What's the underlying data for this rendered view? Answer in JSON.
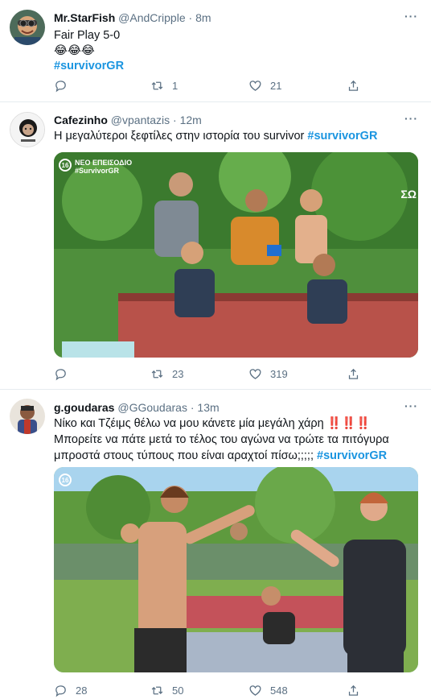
{
  "tweets": [
    {
      "name": "Mr.StarFish",
      "handle": "@AndCripple",
      "time": "8m",
      "line1": "Fair Play 5-0",
      "line2": "😂😂😂",
      "hashtag": "#survivorGR",
      "replies": "",
      "retweets": "1",
      "likes": "21"
    },
    {
      "name": "Cafezinho",
      "handle": "@vpantazis",
      "time": "12m",
      "text": "Η μεγαλύτεροι ξεφτίλες στην ιστορία του survivor",
      "hashtag": "#survivorGR",
      "media_badge": "16",
      "media_overlay": "ΝΕΟ ΕΠΕΙΣΟΔΙΟ #SurvivorGR",
      "media_corner": "ΣΩ",
      "replies": "",
      "retweets": "23",
      "likes": "319"
    },
    {
      "name": "g.goudaras",
      "handle": "@GGoudaras",
      "time": "13m",
      "text_a": "Νίκο και Τζέιμς θέλω να μου κάνετε μία μεγάλη χάρη",
      "excl": "‼️‼️‼️",
      "text_b": "Μπορείτε να πάτε μετά το τέλος του αγώνα να τρώτε τα πιτόγυρα μπροστά στους τύπους που είναι αραχτοί πίσω;;;;;",
      "hashtag": "#survivorGR",
      "media_badge": "16",
      "replies": "28",
      "retweets": "50",
      "likes": "548"
    }
  ],
  "ui": {
    "more_label": "···",
    "separator": "·"
  }
}
